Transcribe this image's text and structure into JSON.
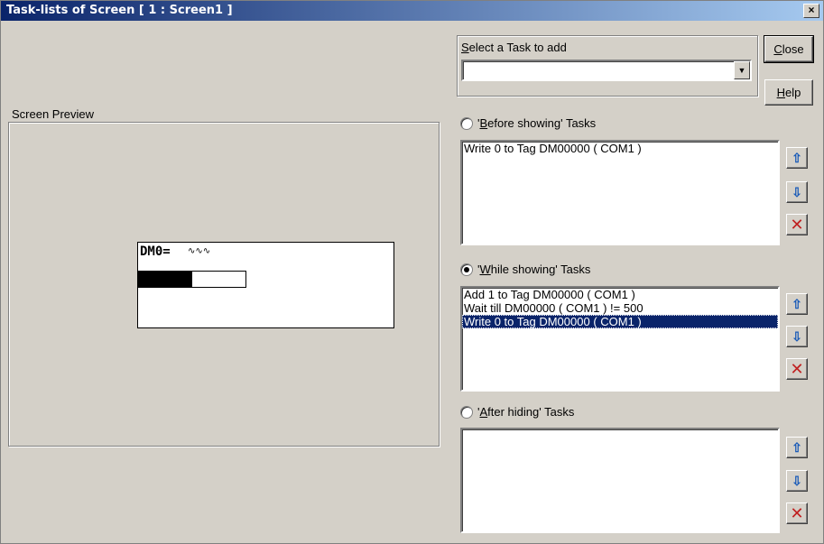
{
  "window": {
    "title": "Task-lists of Screen [ 1 : Screen1 ]",
    "close_glyph": "×"
  },
  "select_task": {
    "label_prefix": "S",
    "label_rest": "elect a Task to add",
    "value": ""
  },
  "buttons": {
    "close_u": "C",
    "close_rest": "lose",
    "help_u": "H",
    "help_rest": "elp"
  },
  "preview": {
    "label": "Screen Preview",
    "lcd_label": "DM0=",
    "lcd_value": "∿∿∿",
    "bar_fill_fraction": 0.5
  },
  "before_tasks": {
    "label_pre": "'",
    "label_u": "B",
    "label_rest": "efore showing' Tasks",
    "selected": false,
    "items": [
      "Write 0 to Tag DM00000 ( COM1 )"
    ]
  },
  "while_tasks": {
    "label_pre": "'",
    "label_u": "W",
    "label_rest": "hile showing' Tasks",
    "selected": true,
    "items": [
      "Add 1 to Tag DM00000 ( COM1 )",
      "Wait till DM00000 ( COM1 ) != 500",
      "Write 0 to Tag DM00000 ( COM1 )"
    ],
    "selected_index": 2
  },
  "after_tasks": {
    "label_pre": "'",
    "label_u": "A",
    "label_rest": "fter hiding' Tasks",
    "selected": false,
    "items": []
  },
  "side_icons": {
    "up": "⇧",
    "down": "⇩",
    "delete": "✕"
  },
  "colors": {
    "title_start": "#0a246a",
    "title_end": "#a6caf0",
    "selection": "#0a246a"
  }
}
